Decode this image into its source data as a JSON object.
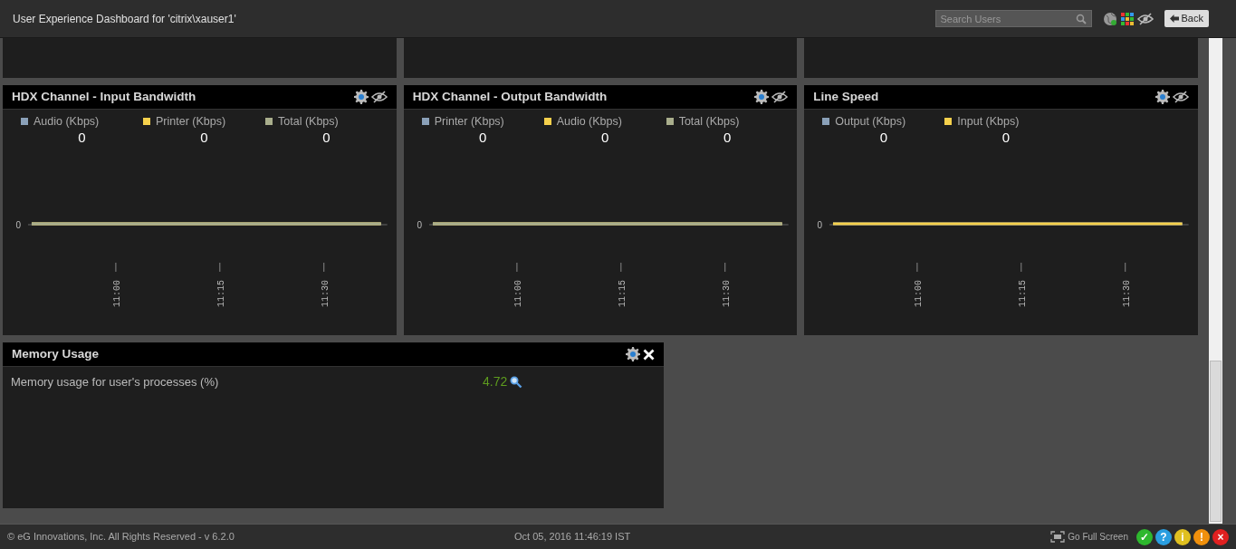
{
  "header": {
    "title": "User Experience Dashboard for 'citrix\\xauser1'",
    "search": {
      "placeholder": "Search Users"
    },
    "back_button": "Back"
  },
  "chart_panels": [
    {
      "title": "HDX Channel - Input Bandwidth",
      "closable": false,
      "legend": [
        {
          "label": "Audio (Kbps)",
          "color": "#8aa0b8",
          "value": "0"
        },
        {
          "label": "Printer (Kbps)",
          "color": "#f5d04c",
          "value": "0"
        },
        {
          "label": "Total (Kbps)",
          "color": "#a9ae8c",
          "value": "0"
        }
      ],
      "plot": {
        "y_label": "0",
        "time_labels": [
          "11:00",
          "11:15",
          "11:30"
        ]
      }
    },
    {
      "title": "HDX Channel - Output Bandwidth",
      "closable": false,
      "legend": [
        {
          "label": "Printer (Kbps)",
          "color": "#8aa0b8",
          "value": "0"
        },
        {
          "label": "Audio (Kbps)",
          "color": "#f5d04c",
          "value": "0"
        },
        {
          "label": "Total (Kbps)",
          "color": "#a9ae8c",
          "value": "0"
        }
      ],
      "plot": {
        "y_label": "0",
        "time_labels": [
          "11:00",
          "11:15",
          "11:30"
        ]
      }
    },
    {
      "title": "Line Speed",
      "closable": false,
      "legend": [
        {
          "label": "Output (Kbps)",
          "color": "#8aa0b8",
          "value": "0"
        },
        {
          "label": "Input (Kbps)",
          "color": "#f5d04c",
          "value": "0"
        }
      ],
      "plot": {
        "y_label": "0",
        "time_labels": [
          "11:00",
          "11:15",
          "11:30"
        ]
      }
    }
  ],
  "memory_panel": {
    "title": "Memory Usage",
    "closable": true,
    "metrics": [
      {
        "label": "Memory usage for user's processes (%)",
        "value": "4.72",
        "color": "#5e9c1e"
      }
    ]
  },
  "footer": {
    "copyright": "© eG Innovations, Inc. All Rights Reserved - v 6.2.0",
    "datetime": "Oct 05, 2016 11:46:19 IST",
    "full_screen": "Go Full Screen",
    "status_buttons": [
      {
        "glyph": "✓",
        "color": "#2eb82e"
      },
      {
        "glyph": "?",
        "color": "#2a9ee0"
      },
      {
        "glyph": "i",
        "color": "#e0c020"
      },
      {
        "glyph": "!",
        "color": "#f0900c"
      },
      {
        "glyph": "×",
        "color": "#e02020"
      }
    ]
  }
}
